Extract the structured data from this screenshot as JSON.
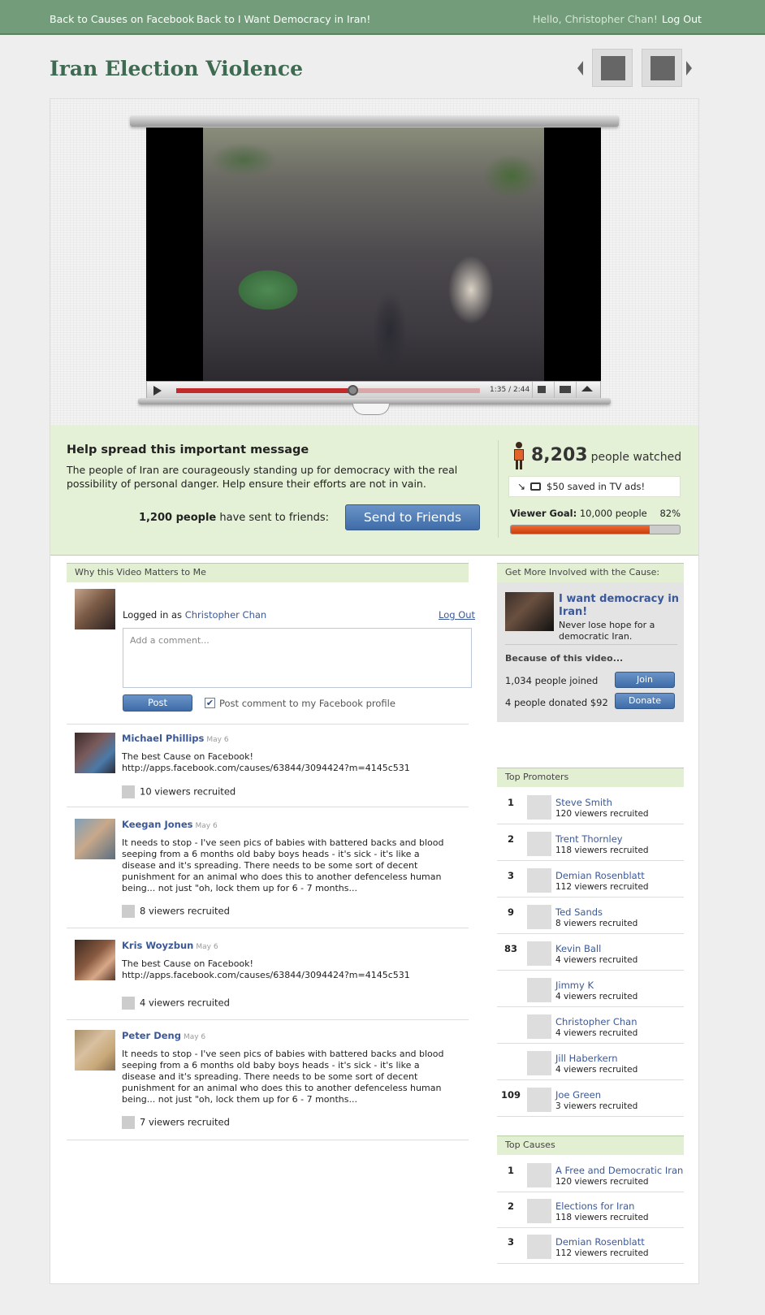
{
  "topbar": {
    "back_causes": "Back to Causes on Facebook",
    "back_cause": "Back to I Want Democracy in Iran!",
    "hello": "Hello, Christopher Chan!",
    "logout": "Log Out"
  },
  "page_title": "Iran Election Violence",
  "video": {
    "time": "1:35 / 2:44",
    "progress": 0.58
  },
  "message": {
    "title": "Help spread this important message",
    "body": "The people of Iran are courageously standing up for democracy with the real possibility of personal danger. Help ensure their efforts are not in vain.",
    "sent_count": "1,200 people",
    "sent_suffix": " have sent to friends:",
    "send_button": "Send to Friends",
    "watched_count": "8,203",
    "watched_label": "people watched",
    "saved": "$50 saved in TV ads!",
    "goal_label": "Viewer Goal:",
    "goal_value": "10,000 people",
    "goal_pct": "82%",
    "goal_fraction": 0.82
  },
  "why": {
    "header": "Why this Video Matters to Me",
    "logged_prefix": "Logged in as ",
    "logged_user": "Christopher Chan",
    "logout": "Log Out",
    "comment_placeholder": "Add a comment...",
    "post_button": "Post",
    "post_checkbox_label": "Post comment to my Facebook profile"
  },
  "comments": [
    {
      "name": "Michael Phillips",
      "date": "May 6",
      "body": "The best Cause on Facebook!\nhttp://apps.facebook.com/causes/63844/3094424?m=4145c531",
      "recruited": "10 viewers recruited"
    },
    {
      "name": "Keegan Jones",
      "date": "May 6",
      "body": "It needs to stop - I've seen pics of babies with battered backs and blood seeping from a 6 months old baby boys heads - it's sick - it's like a disease and it's spreading. There needs to be some sort of decent punishment for an animal who does this to another defenceless human being... not just \"oh, lock them up for 6 - 7 months...",
      "recruited": "8 viewers recruited"
    },
    {
      "name": "Kris Woyzbun",
      "date": "May 6",
      "body": "The best Cause on Facebook!\nhttp://apps.facebook.com/causes/63844/3094424?m=4145c531",
      "recruited": "4 viewers recruited"
    },
    {
      "name": "Peter Deng",
      "date": "May 6",
      "body": "It needs to stop - I've seen pics of babies with battered backs and blood seeping from a 6 months old baby boys heads - it's sick - it's like a disease and it's spreading. There needs to be some sort of decent punishment for an animal who does this to another defenceless human being... not just \"oh, lock them up for 6 - 7 months...",
      "recruited": "7 viewers recruited"
    }
  ],
  "involve": {
    "header": "Get More Involved with the Cause:",
    "cause_title": "I want democracy in Iran!",
    "cause_desc": "Never lose hope for a democratic Iran.",
    "because": "Because of this video...",
    "joined": "1,034 people joined",
    "join_button": "Join",
    "donated": "4 people donated $92",
    "donate_button": "Donate"
  },
  "top_promoters": {
    "header": "Top Promoters",
    "rows": [
      {
        "rank": "1",
        "name": "Steve Smith",
        "sub": "120 viewers recruited"
      },
      {
        "rank": "2",
        "name": "Trent Thornley",
        "sub": "118 viewers recruited"
      },
      {
        "rank": "3",
        "name": "Demian Rosenblatt",
        "sub": "112 viewers recruited"
      },
      {
        "rank": "9",
        "name": "Ted Sands",
        "sub": "8 viewers recruited"
      },
      {
        "rank": "83",
        "name": "Kevin Ball",
        "sub": "4 viewers recruited"
      },
      {
        "rank": "",
        "name": "Jimmy K",
        "sub": "4 viewers recruited"
      },
      {
        "rank": "",
        "name": "Christopher Chan",
        "sub": "4 viewers recruited"
      },
      {
        "rank": "",
        "name": "Jill Haberkern",
        "sub": "4 viewers recruited"
      },
      {
        "rank": "109",
        "name": "Joe Green",
        "sub": "3 viewers recruited"
      }
    ]
  },
  "top_causes": {
    "header": "Top Causes",
    "rows": [
      {
        "rank": "1",
        "name": "A Free and Democratic Iran",
        "sub": "120 viewers recruited"
      },
      {
        "rank": "2",
        "name": "Elections for Iran",
        "sub": "118 viewers recruited"
      },
      {
        "rank": "3",
        "name": "Demian Rosenblatt",
        "sub": "112 viewers recruited"
      }
    ]
  }
}
